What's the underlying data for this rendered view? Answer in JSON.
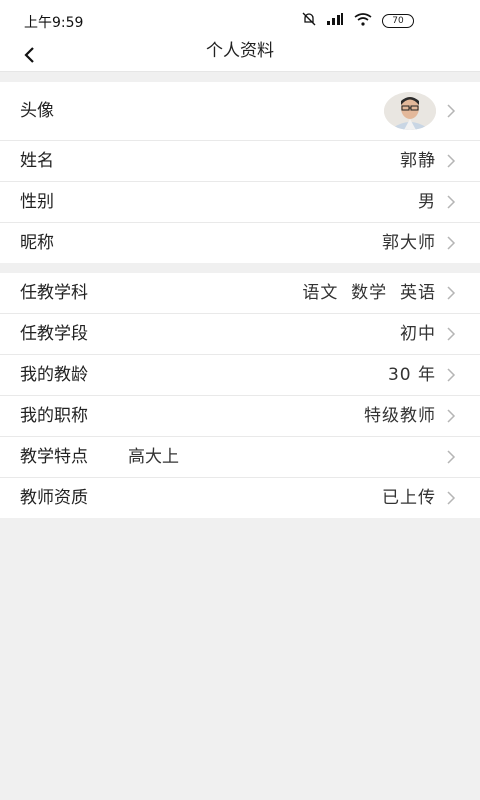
{
  "status_bar": {
    "time": "上午9:59",
    "battery": "70"
  },
  "nav": {
    "title": "个人资料"
  },
  "profile": {
    "avatar_label": "头像",
    "name_label": "姓名",
    "name_value": "郭静",
    "gender_label": "性别",
    "gender_value": "男",
    "nickname_label": "昵称",
    "nickname_value": "郭大师"
  },
  "teaching": {
    "subject_label": "任教学科",
    "subject_value": "语文  数学  英语",
    "stage_label": "任教学段",
    "stage_value": "初中",
    "years_label": "我的教龄",
    "years_value": "30 年",
    "title_label": "我的职称",
    "title_value": "特级教师",
    "feature_label": "教学特点",
    "feature_value": "高大上",
    "qualification_label": "教师资质",
    "qualification_value": "已上传"
  },
  "colors": {
    "background": "#f0f0f0",
    "surface": "#ffffff",
    "chevron": "#b5b5b5"
  }
}
